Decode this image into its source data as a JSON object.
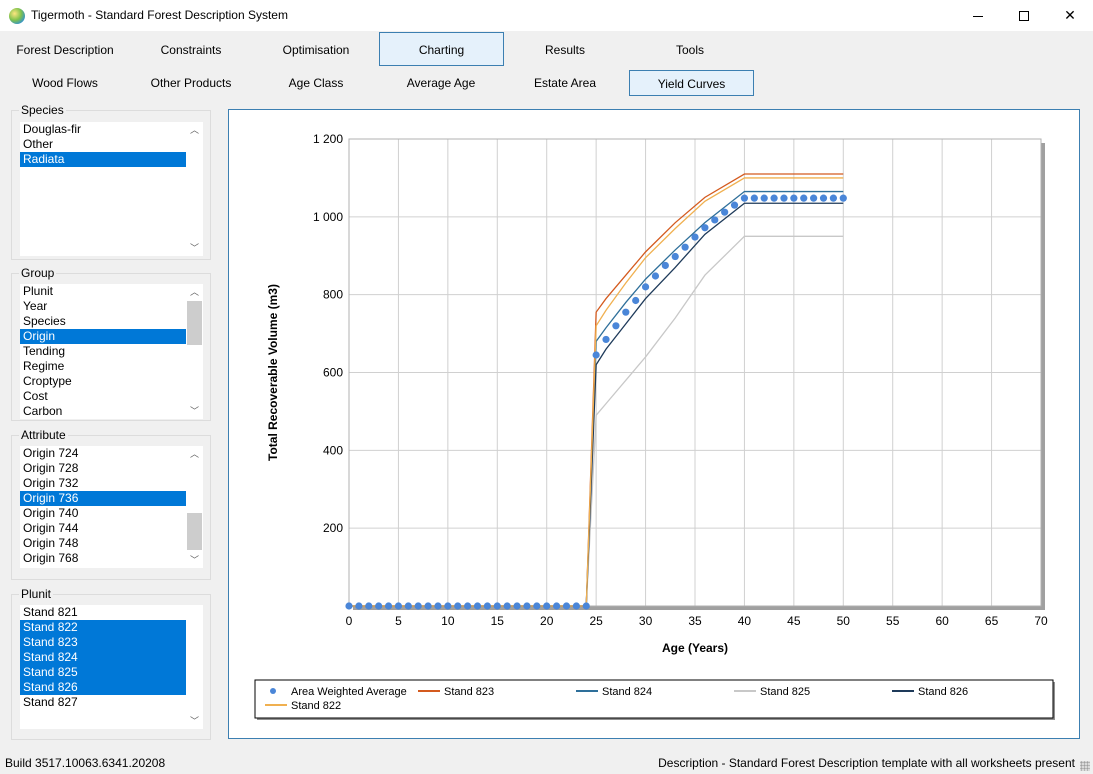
{
  "window": {
    "title": "Tigermoth - Standard Forest Description System"
  },
  "tabs": [
    "Forest Description",
    "Constraints",
    "Optimisation",
    "Charting",
    "Results",
    "Tools"
  ],
  "subtabs": [
    "Wood Flows",
    "Other Products",
    "Age Class",
    "Average Age",
    "Estate Area",
    "Yield Curves"
  ],
  "species": {
    "label": "Species",
    "items": [
      "Douglas-fir",
      "Other",
      "Radiata"
    ],
    "selected": [
      2
    ]
  },
  "group": {
    "label": "Group",
    "items": [
      "Plunit",
      "Year",
      "Species",
      "Origin",
      "Tending",
      "Regime",
      "Croptype",
      "Cost",
      "Carbon"
    ],
    "selected": [
      3
    ]
  },
  "attribute": {
    "label": "Attribute",
    "items": [
      "Origin 724",
      "Origin 728",
      "Origin 732",
      "Origin 736",
      "Origin 740",
      "Origin 744",
      "Origin 748",
      "Origin 768"
    ],
    "selected": [
      3
    ]
  },
  "plunit": {
    "label": "Plunit",
    "items": [
      "Stand 821",
      "Stand 822",
      "Stand 823",
      "Stand 824",
      "Stand 825",
      "Stand 826",
      "Stand 827"
    ],
    "selected": [
      1,
      2,
      3,
      4,
      5
    ]
  },
  "chart_data": {
    "type": "line",
    "xlabel": "Age (Years)",
    "ylabel": "Total Recoverable Volume (m3)",
    "xlim": [
      0,
      70
    ],
    "ylim": [
      0,
      1200
    ],
    "xticks": [
      "0",
      "5",
      "10",
      "15",
      "20",
      "25",
      "30",
      "35",
      "40",
      "45",
      "50",
      "55",
      "60",
      "65",
      "70"
    ],
    "yticks": [
      "200",
      "400",
      "600",
      "800",
      "1 000",
      "1 200"
    ],
    "grid": true,
    "legend_position": "bottom",
    "series": [
      {
        "name": "Area Weighted Average",
        "style": "markers",
        "color": "#4a86d8",
        "x": [
          0,
          1,
          2,
          3,
          4,
          5,
          6,
          7,
          8,
          9,
          10,
          11,
          12,
          13,
          14,
          15,
          16,
          17,
          18,
          19,
          20,
          21,
          22,
          23,
          24,
          25,
          26,
          27,
          28,
          29,
          30,
          31,
          32,
          33,
          34,
          35,
          36,
          37,
          38,
          39,
          40,
          41,
          42,
          43,
          44,
          45,
          46,
          47,
          48,
          49,
          50
        ],
        "y": [
          0,
          0,
          0,
          0,
          0,
          0,
          0,
          0,
          0,
          0,
          0,
          0,
          0,
          0,
          0,
          0,
          0,
          0,
          0,
          0,
          0,
          0,
          0,
          0,
          0,
          645,
          685,
          720,
          755,
          785,
          820,
          848,
          875,
          898,
          922,
          948,
          972,
          992,
          1012,
          1030,
          1048,
          1048,
          1048,
          1048,
          1048,
          1048,
          1048,
          1048,
          1048,
          1048,
          1048
        ]
      },
      {
        "name": "Stand 823",
        "color": "#d45a1e",
        "x": [
          0,
          24,
          25,
          26,
          28,
          30,
          33,
          36,
          40,
          50
        ],
        "y": [
          0,
          0,
          755,
          790,
          850,
          910,
          985,
          1050,
          1110,
          1110
        ]
      },
      {
        "name": "Stand 824",
        "color": "#2e6f9a",
        "x": [
          0,
          24,
          25,
          26,
          28,
          30,
          33,
          36,
          40,
          50
        ],
        "y": [
          0,
          0,
          680,
          715,
          780,
          840,
          915,
          985,
          1065,
          1065
        ]
      },
      {
        "name": "Stand 825",
        "color": "#c8c8c8",
        "x": [
          0,
          24,
          25,
          26,
          28,
          30,
          33,
          36,
          40,
          50
        ],
        "y": [
          0,
          0,
          490,
          520,
          580,
          640,
          740,
          850,
          950,
          950
        ]
      },
      {
        "name": "Stand 826",
        "color": "#1e3a5a",
        "x": [
          0,
          24,
          25,
          26,
          28,
          30,
          33,
          36,
          40,
          50
        ],
        "y": [
          0,
          0,
          620,
          660,
          725,
          790,
          870,
          955,
          1035,
          1035
        ]
      },
      {
        "name": "Stand 822",
        "color": "#f0b050",
        "x": [
          0,
          24,
          25,
          26,
          28,
          30,
          33,
          36,
          40,
          50
        ],
        "y": [
          0,
          0,
          720,
          760,
          830,
          895,
          970,
          1040,
          1100,
          1100
        ]
      }
    ]
  },
  "status": {
    "build": "Build 3517.10063.6341.20208",
    "description": "Description - Standard Forest Description template with all worksheets present"
  },
  "colors": {
    "accent": "#0078d7",
    "tab_border": "#3c7fb1"
  }
}
